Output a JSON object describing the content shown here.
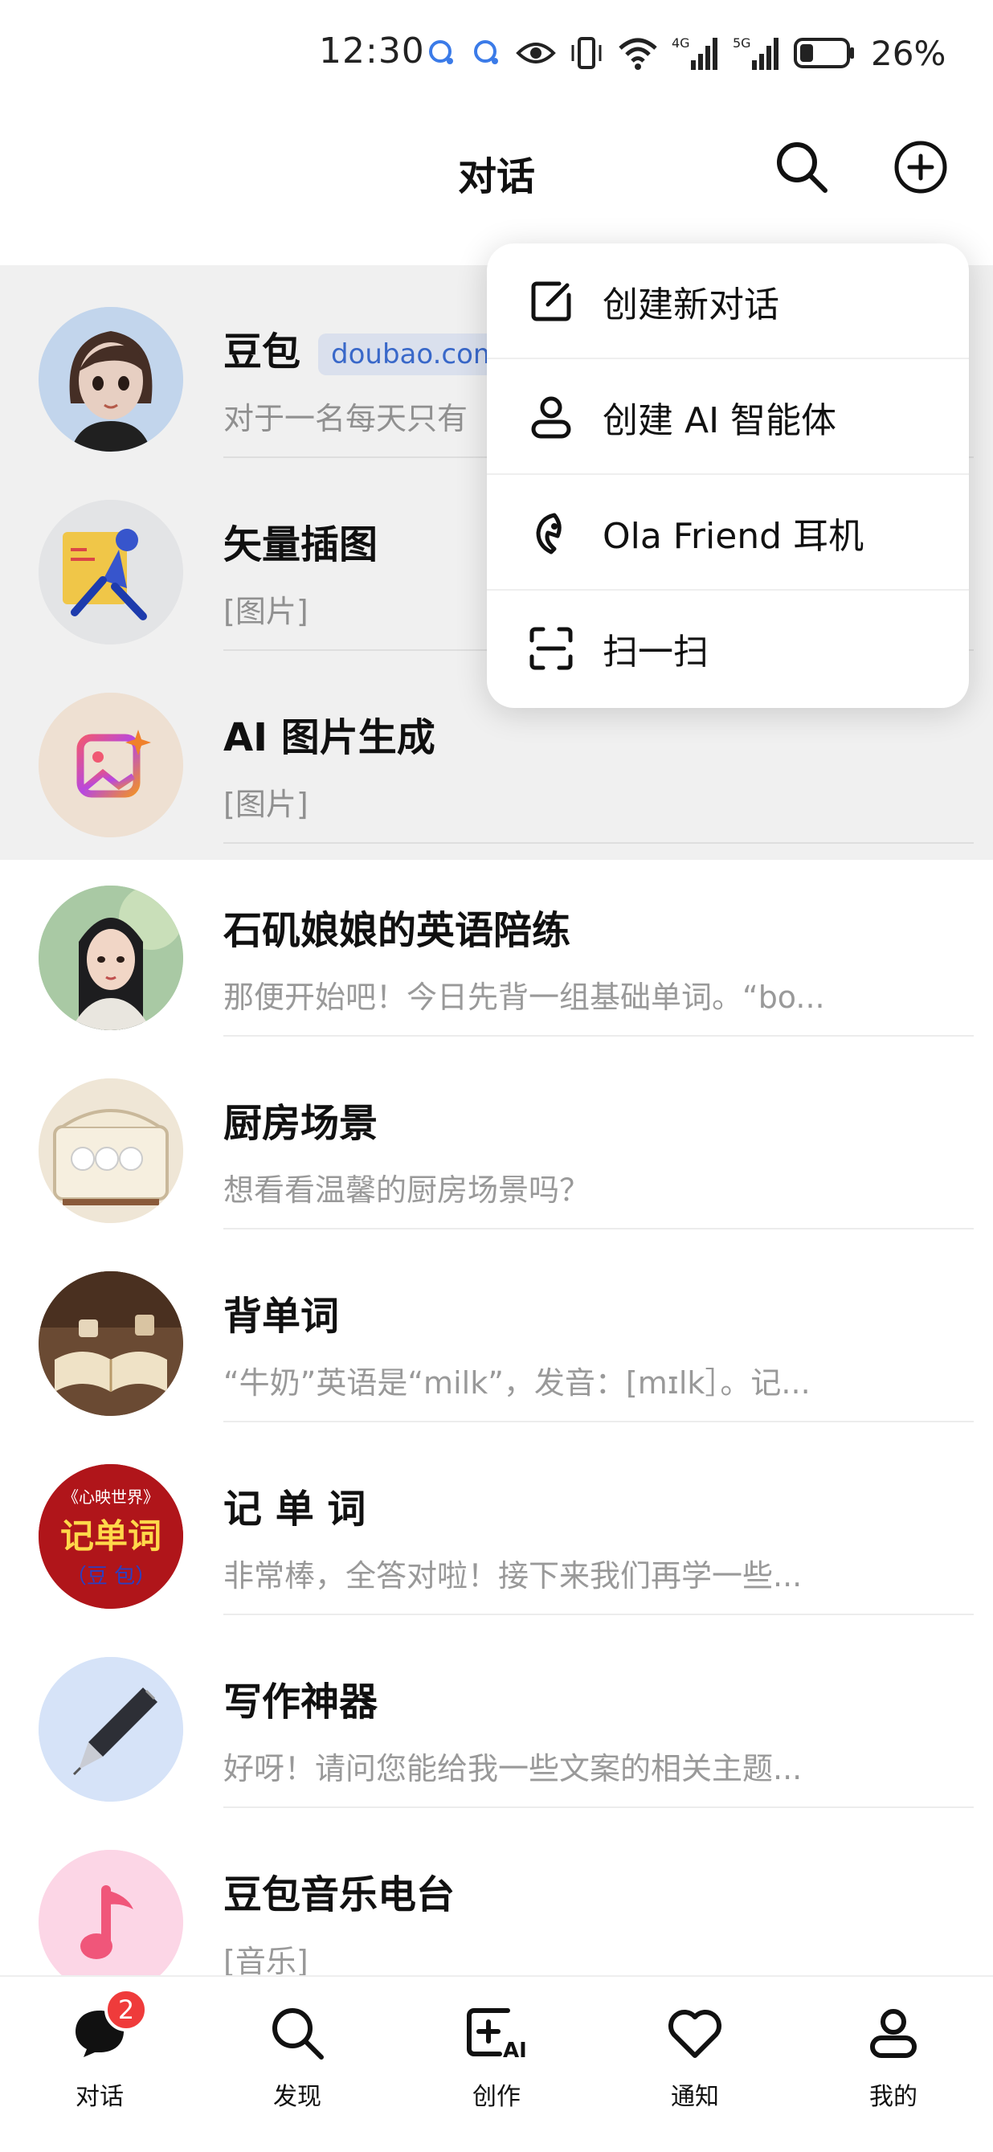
{
  "status_bar": {
    "time": "12:30",
    "battery": "26%",
    "icons": [
      "chat-bubble-icon",
      "chat-bubble-icon",
      "eye-icon",
      "vibrate-icon",
      "wifi-icon",
      "signal-4g-icon",
      "signal-5g-icon",
      "battery-icon"
    ]
  },
  "header": {
    "title": "对话",
    "icons": [
      "search-icon",
      "plus-circle-icon"
    ]
  },
  "menu": {
    "items": [
      {
        "label": "创建新对话",
        "icon": "edit-icon"
      },
      {
        "label": "创建 AI 智能体",
        "icon": "person-icon"
      },
      {
        "label": "Ola Friend 耳机",
        "icon": "earphone-icon"
      },
      {
        "label": "扫一扫",
        "icon": "scan-icon"
      }
    ]
  },
  "chats": [
    {
      "name": "豆包",
      "tag": "doubao.com",
      "preview": "对于一名每天只有",
      "avatar": "doubao-avatar"
    },
    {
      "name": "矢量插图",
      "preview": "[图片]",
      "avatar": "vector-illustration-avatar"
    },
    {
      "name": "AI 图片生成",
      "preview": "[图片]",
      "avatar": "ai-image-avatar"
    },
    {
      "name": "石矶娘娘的英语陪练",
      "preview": "那便开始吧！今日先背一组基础单词。“bo...",
      "avatar": "portrait-avatar"
    },
    {
      "name": "厨房场景",
      "preview": "想看看温馨的厨房场景吗？",
      "avatar": "kitchen-avatar"
    },
    {
      "name": "背单词",
      "preview": "“牛奶”英语是“milk”，发音：[mɪlk］。记...",
      "avatar": "book-avatar"
    },
    {
      "name": "记 单 词",
      "preview": "非常棒，全答对啦！接下来我们再学一些...",
      "avatar": "word-avatar",
      "avatar_text_top": "《心映世界》",
      "avatar_text_main": "记单词",
      "avatar_text_bottom": "（豆 包）"
    },
    {
      "name": "写作神器",
      "preview": "好呀！请问您能给我一些文案的相关主题...",
      "avatar": "pen-avatar"
    },
    {
      "name": "豆包音乐电台",
      "preview": "[音乐]",
      "avatar": "music-avatar"
    }
  ],
  "bottom_nav": {
    "items": [
      {
        "label": "对话",
        "icon": "chat-icon",
        "badge": "2"
      },
      {
        "label": "发现",
        "icon": "search-icon"
      },
      {
        "label": "创作",
        "icon": "create-ai-icon",
        "icon_text": "AI"
      },
      {
        "label": "通知",
        "icon": "heart-icon"
      },
      {
        "label": "我的",
        "icon": "profile-icon"
      }
    ]
  },
  "colors": {
    "tag_text": "#3d6fd6",
    "tag_bg": "#e8effc",
    "badge": "#ef3b3b"
  }
}
